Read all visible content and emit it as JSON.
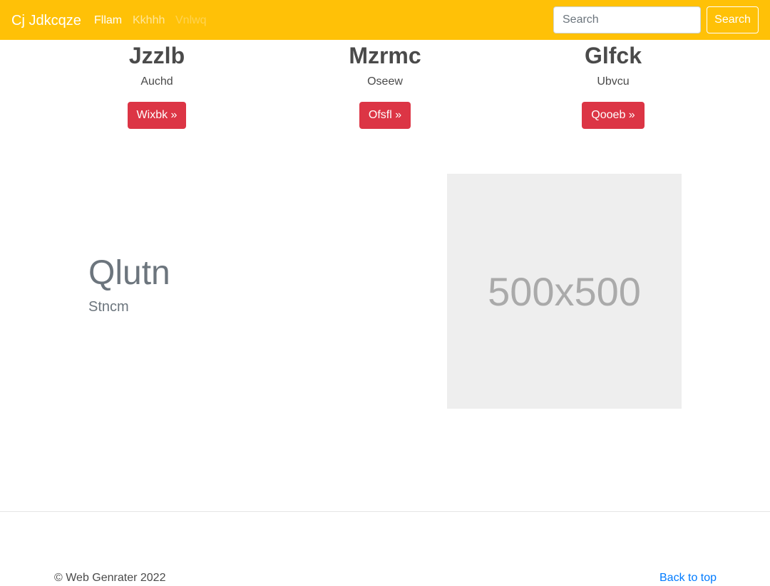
{
  "navbar": {
    "brand": "Cj Jdkcqze",
    "links": [
      "Fllam",
      "Kkhhh",
      "Vnlwq"
    ],
    "search_placeholder": "Search",
    "search_button": "Search",
    "background_color": "#ffc107"
  },
  "columns": [
    {
      "heading": "Jzzlb",
      "text": "Auchd",
      "button": "Wixbk »"
    },
    {
      "heading": "Mzrmc",
      "text": "Oseew",
      "button": "Ofsfl »"
    },
    {
      "heading": "Glfck",
      "text": "Ubvcu",
      "button": "Qooeb »"
    }
  ],
  "featurette": {
    "heading": "Qlutn",
    "subheading": "Stncm",
    "image_label": "500x500"
  },
  "footer": {
    "copyright": "© Web Genrater 2022",
    "back_to_top": "Back to top"
  },
  "colors": {
    "button": "#dc3545",
    "link": "#007bff"
  }
}
